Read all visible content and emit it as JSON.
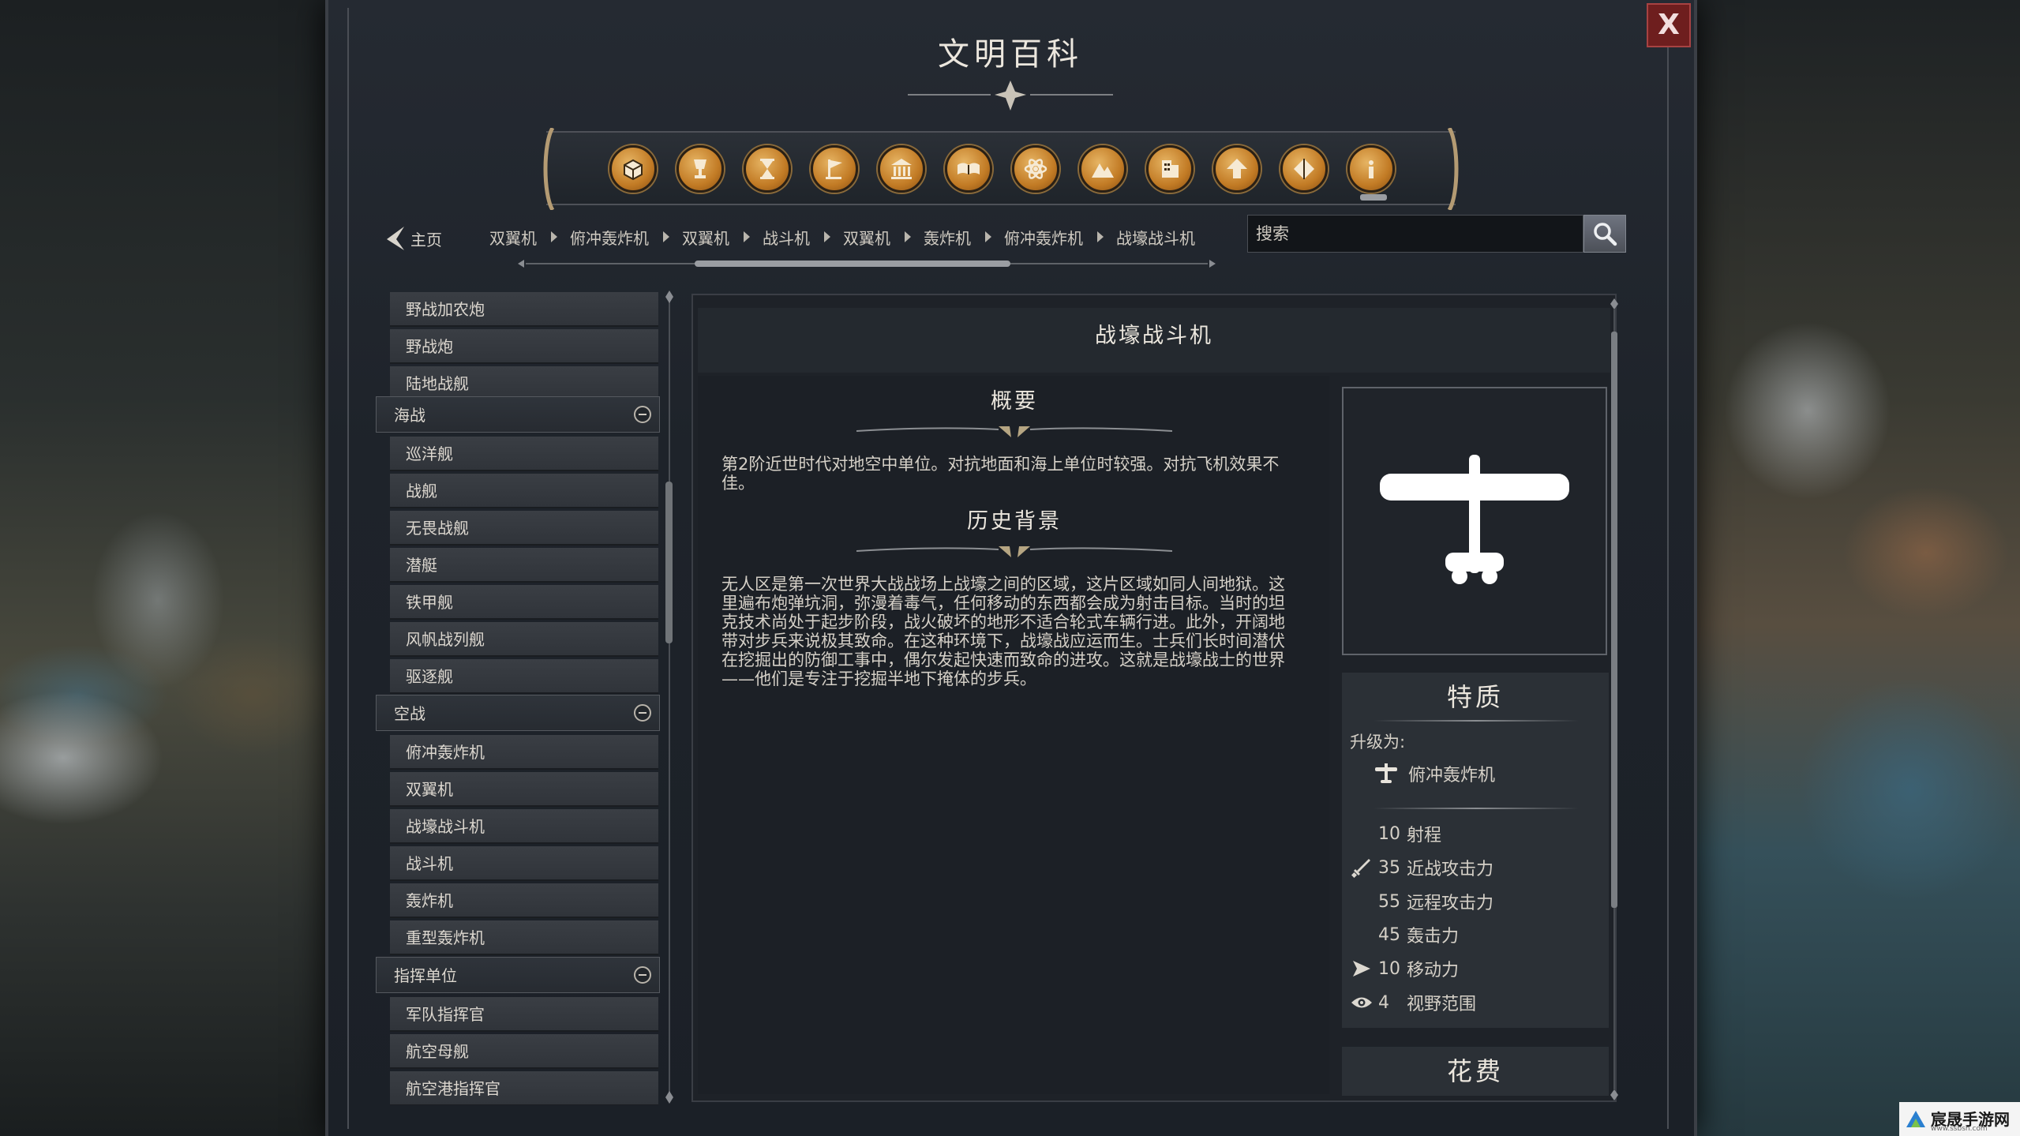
{
  "window": {
    "title": "文明百科",
    "close_label": "X"
  },
  "toolbar": {
    "icons": [
      "box-icon",
      "goblet-icon",
      "hourglass-icon",
      "flag-icon",
      "institution-icon",
      "book-icon",
      "atom-icon",
      "mountain-icon",
      "building-icon",
      "arrow-up-icon",
      "diamond-icon",
      "info-icon"
    ]
  },
  "nav": {
    "home_label": "主页",
    "breadcrumbs": [
      "双翼机",
      "俯冲轰炸机",
      "双翼机",
      "战斗机",
      "双翼机",
      "轰炸机",
      "俯冲轰炸机",
      "战壕战斗机"
    ],
    "search_placeholder": "搜索"
  },
  "sidebar": {
    "groups": [
      {
        "items": [
          "野战加农炮",
          "野战炮",
          "陆地战舰"
        ]
      },
      {
        "category": "海战",
        "items": [
          "巡洋舰",
          "战舰",
          "无畏战舰",
          "潜艇",
          "铁甲舰",
          "风帆战列舰",
          "驱逐舰"
        ]
      },
      {
        "category": "空战",
        "items": [
          "俯冲轰炸机",
          "双翼机",
          "战壕战斗机",
          "战斗机",
          "轰炸机",
          "重型轰炸机"
        ]
      },
      {
        "category": "指挥单位",
        "items": [
          "军队指挥官",
          "航空母舰",
          "航空港指挥官"
        ]
      }
    ]
  },
  "detail": {
    "title": "战壕战斗机",
    "overview_title": "概要",
    "overview_text": "第2阶近世时代对地空中单位。对抗地面和海上单位时较强。对抗飞机效果不佳。",
    "history_title": "历史背景",
    "history_text": "无人区是第一次世界大战战场上战壕之间的区域，这片区域如同人间地狱。这里遍布炮弹坑洞，弥漫着毒气，任何移动的东西都会成为射击目标。当时的坦克技术尚处于起步阶段，战火破坏的地形不适合轮式车辆行进。此外，开阔地带对步兵来说极其致命。在这种环境下，战壕战应运而生。士兵们长时间潜伏在挖掘出的防御工事中，偶尔发起快速而致命的进攻。这就是战壕战士的世界——他们是专注于挖掘半地下掩体的步兵。",
    "traits_title": "特质",
    "upgrade_label": "升级为:",
    "upgrade_target": "俯冲轰炸机",
    "stats": [
      {
        "icon": "",
        "value": "10",
        "label": "射程"
      },
      {
        "icon": "sword-icon",
        "value": "35",
        "label": "近战攻击力"
      },
      {
        "icon": "",
        "value": "55",
        "label": "远程攻击力"
      },
      {
        "icon": "",
        "value": "45",
        "label": "轰击力"
      },
      {
        "icon": "movement-arrow-icon",
        "value": "10",
        "label": "移动力"
      },
      {
        "icon": "eye-icon",
        "value": "4",
        "label": "视野范围"
      }
    ],
    "cost_title": "花费"
  },
  "watermark": {
    "text": "宸晟手游网",
    "sub": "www.ssbsh.com"
  },
  "colors": {
    "icon_gold": "#c27b25",
    "close_red": "#6e1e1e",
    "panel": "#1e2228"
  }
}
